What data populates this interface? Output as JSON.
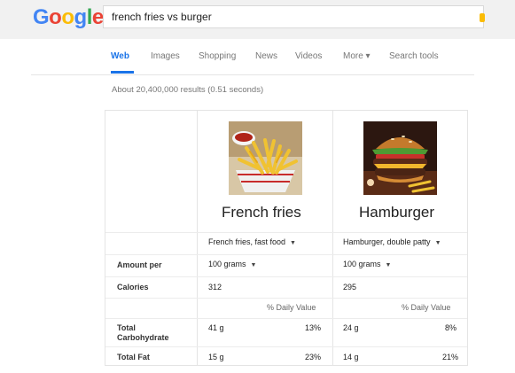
{
  "header": {
    "logo_parts": [
      "G",
      "o",
      "o",
      "g",
      "l",
      "e"
    ],
    "query": "french fries vs burger"
  },
  "tabs": [
    "Web",
    "Images",
    "Shopping",
    "News",
    "Videos",
    "More ▾",
    "Search tools"
  ],
  "result_stats": "About 20,400,000 results (0.51 seconds)",
  "comparison": {
    "foods": [
      {
        "name": "French fries",
        "variant": "French fries, fast food",
        "amount": "100 grams",
        "calories": "312",
        "carb_value": "41 g",
        "carb_pct": "13%",
        "fat_value": "15 g",
        "fat_pct": "23%"
      },
      {
        "name": "Hamburger",
        "variant": "Hamburger, double patty",
        "amount": "100 grams",
        "calories": "295",
        "carb_value": "24 g",
        "carb_pct": "8%",
        "fat_value": "14 g",
        "fat_pct": "21%"
      }
    ],
    "row_labels": {
      "amount_per": "Amount per",
      "calories": "Calories",
      "total_carbohydrate_1": "Total",
      "total_carbohydrate_2": "Carbohydrate",
      "total_fat": "Total Fat"
    },
    "daily_value_label": "% Daily Value"
  }
}
